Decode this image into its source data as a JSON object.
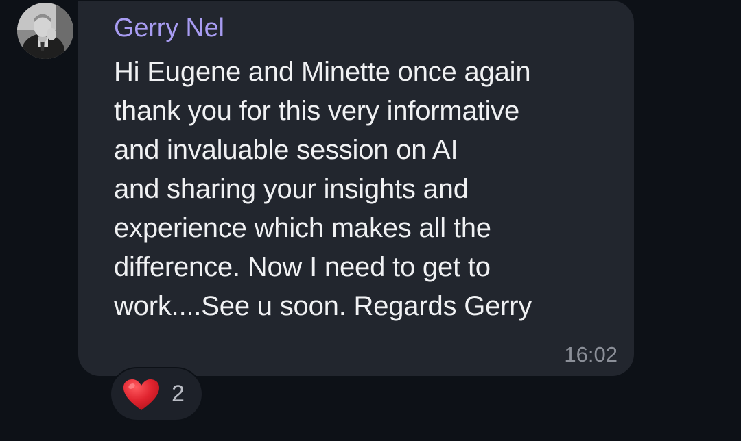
{
  "message": {
    "sender_name": "Gerry Nel",
    "text": "Hi Eugene and Minette once again\nthank you for this very informative\nand invaluable session on AI\nand sharing your insights and\nexperience which makes all the\ndifference. Now I need to get to\nwork....See u soon. Regards Gerry",
    "time": "16:02",
    "avatar_icon": "user-photo",
    "reaction": {
      "icon": "red-heart-icon",
      "count": "2"
    }
  },
  "colors": {
    "background": "#0d1117",
    "bubble": "#22262e",
    "sender_name": "#a89cf2",
    "message_text": "#f0f1f3",
    "timestamp": "#8b8f98",
    "heart": "#e0242f"
  }
}
